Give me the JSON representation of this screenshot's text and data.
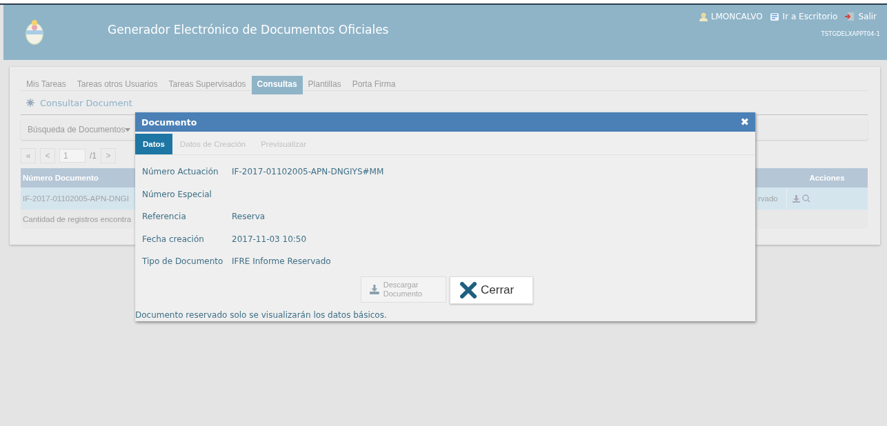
{
  "header": {
    "title": "Generador Electrónico de Documentos Oficiales",
    "user": "LMONCALVO",
    "links": [
      {
        "label": "Ir a Escritorio",
        "kind": "desk"
      },
      {
        "label": "Salir",
        "kind": "exit"
      }
    ],
    "server": "TSTGDELXAPPT04-1"
  },
  "tabs": [
    {
      "label": "Mis Tareas",
      "selected": false
    },
    {
      "label": "Tareas otros Usuarios",
      "selected": false
    },
    {
      "label": "Tareas Supervisados",
      "selected": false
    },
    {
      "label": "Consultas",
      "selected": true
    },
    {
      "label": "Plantillas",
      "selected": false
    },
    {
      "label": "Porta Firma",
      "selected": false
    }
  ],
  "section": {
    "title": "Consultar Document"
  },
  "search_bar": {
    "label": "Búsqueda de Documentos"
  },
  "pagination": {
    "first": "«",
    "prev": "<",
    "page": "1",
    "total": "/1",
    "next": ">"
  },
  "table": {
    "columns": [
      "Número Documento",
      "Acciones"
    ],
    "rows": [
      {
        "number": "IF-2017-01102005-APN-DNGI",
        "type": "rvado",
        "selected": true
      }
    ],
    "footer": "Cantidad de registros encontra"
  },
  "dialog": {
    "title": "Documento",
    "close": "✖",
    "tabs": [
      {
        "label": "Datos",
        "selected": true
      },
      {
        "label": "Datos de Creación",
        "selected": false
      },
      {
        "label": "Previsualizar",
        "selected": false
      }
    ],
    "fields": [
      {
        "label": "Número Actuación",
        "value": "IF-2017-01102005-APN-DNGIYS#MM"
      },
      {
        "label": "Número Especial"
      },
      {
        "label": "Referencia",
        "value": "Reserva"
      },
      {
        "label": "Fecha creación",
        "value": "2017-11-03 10:50"
      },
      {
        "label": "Tipo de Documento",
        "value": "IFRE Informe Reservado"
      }
    ],
    "buttons": [
      {
        "kind": "download",
        "label": "Descargar Documento",
        "disabled": true
      },
      {
        "kind": "close",
        "label": "Cerrar",
        "disabled": false
      }
    ],
    "note": "Documento reservado solo se visualizarán los datos básicos."
  }
}
